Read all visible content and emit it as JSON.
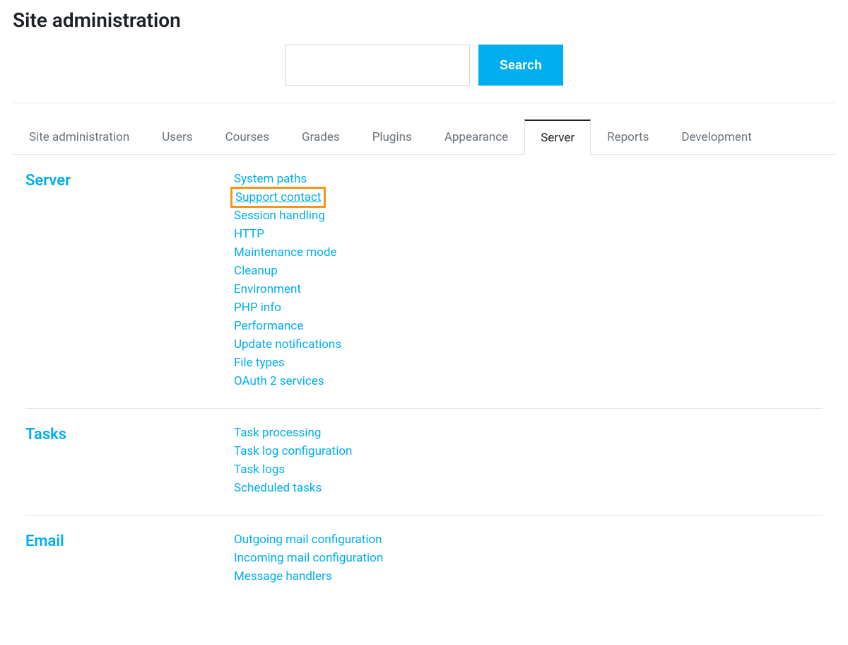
{
  "page_title": "Site administration",
  "search": {
    "value": "",
    "button_label": "Search"
  },
  "tabs": [
    {
      "label": "Site administration",
      "active": false
    },
    {
      "label": "Users",
      "active": false
    },
    {
      "label": "Courses",
      "active": false
    },
    {
      "label": "Grades",
      "active": false
    },
    {
      "label": "Plugins",
      "active": false
    },
    {
      "label": "Appearance",
      "active": false
    },
    {
      "label": "Server",
      "active": true
    },
    {
      "label": "Reports",
      "active": false
    },
    {
      "label": "Development",
      "active": false
    }
  ],
  "sections": [
    {
      "title": "Server",
      "links": [
        {
          "label": "System paths",
          "highlighted": false
        },
        {
          "label": "Support contact",
          "highlighted": true
        },
        {
          "label": "Session handling",
          "highlighted": false
        },
        {
          "label": "HTTP",
          "highlighted": false
        },
        {
          "label": "Maintenance mode",
          "highlighted": false
        },
        {
          "label": "Cleanup",
          "highlighted": false
        },
        {
          "label": "Environment",
          "highlighted": false
        },
        {
          "label": "PHP info",
          "highlighted": false
        },
        {
          "label": "Performance",
          "highlighted": false
        },
        {
          "label": "Update notifications",
          "highlighted": false
        },
        {
          "label": "File types",
          "highlighted": false
        },
        {
          "label": "OAuth 2 services",
          "highlighted": false
        }
      ]
    },
    {
      "title": "Tasks",
      "links": [
        {
          "label": "Task processing",
          "highlighted": false
        },
        {
          "label": "Task log configuration",
          "highlighted": false
        },
        {
          "label": "Task logs",
          "highlighted": false
        },
        {
          "label": "Scheduled tasks",
          "highlighted": false
        }
      ]
    },
    {
      "title": "Email",
      "links": [
        {
          "label": "Outgoing mail configuration",
          "highlighted": false
        },
        {
          "label": "Incoming mail configuration",
          "highlighted": false
        },
        {
          "label": "Message handlers",
          "highlighted": false
        }
      ]
    }
  ]
}
